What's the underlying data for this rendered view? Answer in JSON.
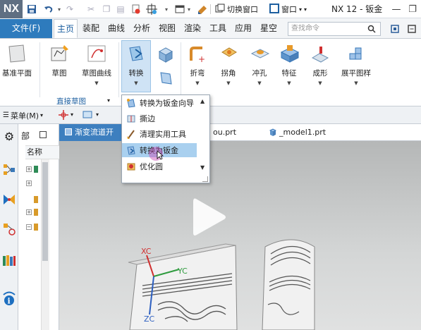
{
  "title_bar": {
    "logo": "NX",
    "switch_window": "切换窗口",
    "window_menu": "窗口",
    "app_title": "NX 12 - 钣金"
  },
  "tabs": {
    "file": "文件(F)",
    "items": [
      "主页",
      "装配",
      "曲线",
      "分析",
      "视图",
      "渲染",
      "工具",
      "应用",
      "星空"
    ],
    "active": "主页",
    "search_placeholder": "查找命令"
  },
  "ribbon": {
    "buttons": {
      "datum_plane": "基准平面",
      "sketch": "草图",
      "sketch_curve": "草图曲线",
      "convert": "转换",
      "bend": "折弯",
      "corner": "拐角",
      "punch": "冲孔",
      "feature": "特征",
      "form": "成形",
      "flat_pattern": "展平图样"
    },
    "group_label": "直接草图"
  },
  "subbar": {
    "menu": "菜单(M)"
  },
  "navigator": {
    "title": "部",
    "column_header": "名称"
  },
  "doc_tabs": {
    "active": "渐变流道开",
    "tab2": "ou.prt",
    "tab3": "_model1.prt"
  },
  "dropdown": {
    "items": [
      {
        "label": "转换为钣金向导",
        "icon": "wizard-icon"
      },
      {
        "label": "撕边",
        "icon": "rip-icon"
      },
      {
        "label": "清理实用工具",
        "icon": "brush-icon"
      },
      {
        "label": "转换为钣金",
        "icon": "convert-icon",
        "highlighted": true
      },
      {
        "label": "优化圆",
        "icon": "optimize-icon"
      }
    ]
  },
  "viewport": {
    "axis_xc": "XC",
    "axis_yc": "YC",
    "axis_zc": "ZC"
  }
}
